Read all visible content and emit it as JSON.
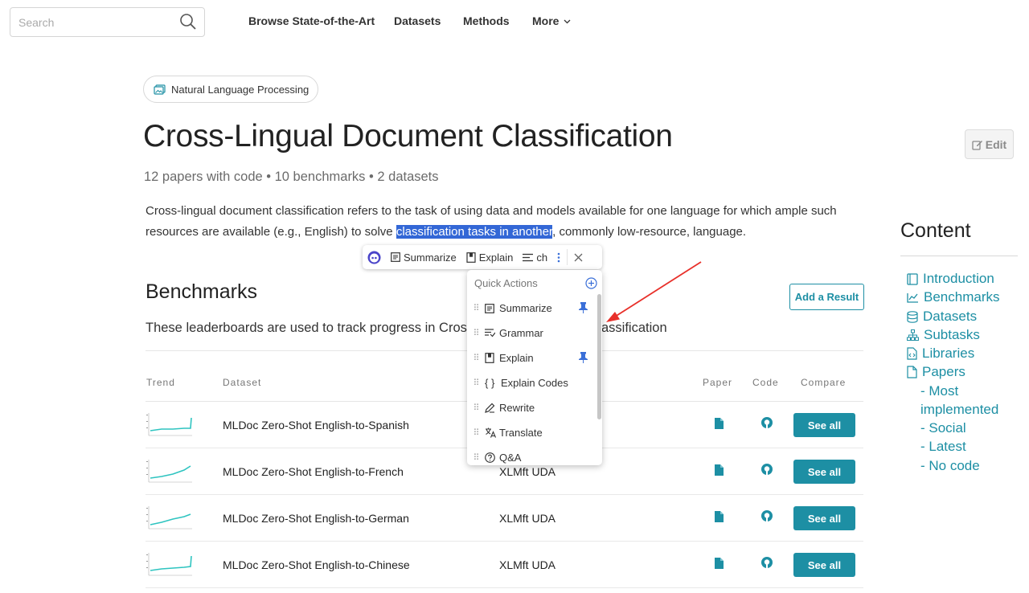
{
  "header": {
    "search_placeholder": "Search",
    "nav": [
      "Browse State-of-the-Art",
      "Datasets",
      "Methods",
      "More"
    ]
  },
  "area_chip": "Natural Language Processing",
  "title": "Cross-Lingual Document Classification",
  "stats": "12 papers with code • 10 benchmarks • 2 datasets",
  "description": {
    "before": "Cross-lingual document classification refers to the task of using data and models available for one language for which ample such resources are available (e.g., English) to solve ",
    "highlight": "classification tasks in another",
    "after": ", commonly low-resource, language."
  },
  "edit_label": "Edit",
  "selection_toolbar": {
    "summarize": "Summarize",
    "explain": "Explain",
    "ch": "ch"
  },
  "quick_actions": {
    "heading": "Quick Actions",
    "items": [
      "Summarize",
      "Grammar",
      "Explain",
      "Explain Codes",
      "Rewrite",
      "Translate",
      "Q&A"
    ]
  },
  "benchmarks": {
    "heading": "Benchmarks",
    "add_result": "Add a Result",
    "description_left": "These leaderboards are used to track progress in Cros",
    "description_right": "assification",
    "columns": [
      "Trend",
      "Dataset",
      "Paper",
      "Code",
      "Compare"
    ],
    "rows": [
      {
        "dataset": "MLDoc Zero-Shot English-to-Spanish",
        "model": "",
        "see_all": "See all"
      },
      {
        "dataset": "MLDoc Zero-Shot English-to-French",
        "model": "XLMft UDA",
        "see_all": "See all"
      },
      {
        "dataset": "MLDoc Zero-Shot English-to-German",
        "model": "XLMft UDA",
        "see_all": "See all"
      },
      {
        "dataset": "MLDoc Zero-Shot English-to-Chinese",
        "model": "XLMft UDA",
        "see_all": "See all"
      }
    ]
  },
  "toc": {
    "heading": "Content",
    "items": [
      "Introduction",
      "Benchmarks",
      "Datasets",
      "Subtasks",
      "Libraries",
      "Papers"
    ],
    "sub_items": [
      "- Most",
      "implemented",
      "- Social",
      "- Latest",
      "- No code"
    ]
  },
  "colors": {
    "accent": "#1d8fa4",
    "highlight": "#3367d6",
    "pin": "#3a6fd8",
    "arrow": "#e8302a"
  }
}
